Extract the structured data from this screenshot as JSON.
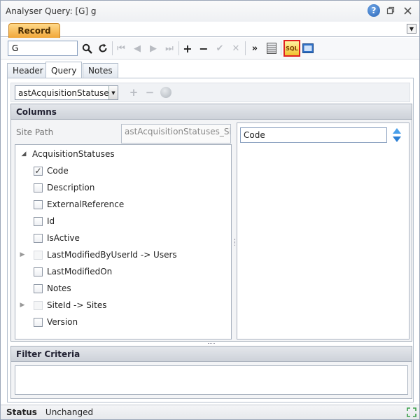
{
  "window": {
    "title": "Analyser Query: [G] g",
    "help_icon": "?",
    "restore_icon": "⧉",
    "close_icon": "✕"
  },
  "record_tab": {
    "label": "Record"
  },
  "toolbar": {
    "record_value": "G",
    "sql_label": "SQL",
    "icons": {
      "search": "search-icon",
      "refresh": "refresh-icon",
      "first": "first-icon",
      "previous": "previous-icon",
      "next": "next-icon",
      "last": "last-icon",
      "add": "add-icon",
      "remove": "remove-icon",
      "confirm": "check-icon",
      "cancel": "cancel-icon",
      "more": "double-chevron-icon",
      "grid": "grid-icon",
      "sql": "sql-icon",
      "view": "view-icon"
    }
  },
  "inner_tabs": [
    {
      "label": "Header"
    },
    {
      "label": "Query"
    },
    {
      "label": "Notes"
    }
  ],
  "query": {
    "entity_selected": "astAcquisitionStatuses",
    "columns_header": "Columns",
    "site_path_label": "Site Path",
    "site_path_value": "astAcquisitionStatuses_Sit",
    "tree_root": "AcquisitionStatuses",
    "fields": [
      {
        "label": "Code",
        "checked": true,
        "expandable": false
      },
      {
        "label": "Description",
        "checked": false,
        "expandable": false
      },
      {
        "label": "ExternalReference",
        "checked": false,
        "expandable": false
      },
      {
        "label": "Id",
        "checked": false,
        "expandable": false
      },
      {
        "label": "IsActive",
        "checked": false,
        "expandable": false
      },
      {
        "label": "LastModifiedByUserId -> Users",
        "checked": false,
        "expandable": true
      },
      {
        "label": "LastModifiedOn",
        "checked": false,
        "expandable": false
      },
      {
        "label": "Notes",
        "checked": false,
        "expandable": false
      },
      {
        "label": "SiteId -> Sites",
        "checked": false,
        "expandable": true
      },
      {
        "label": "Version",
        "checked": false,
        "expandable": false
      }
    ],
    "selected_columns": [
      "Code"
    ],
    "filter_header": "Filter Criteria"
  },
  "status": {
    "label": "Status",
    "value": "Unchanged"
  }
}
